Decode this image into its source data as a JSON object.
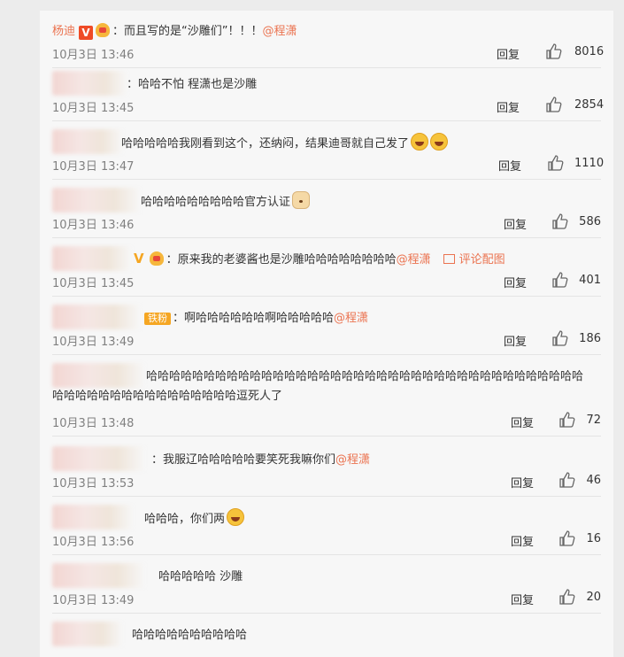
{
  "comments": [
    {
      "name": "杨迪",
      "vip": "V",
      "text": "：而且写的是“沙雕们”！！！",
      "mention": "@程潇",
      "time": "10月3日 13:46",
      "reply": "回复",
      "likes": "8016"
    },
    {
      "name": "",
      "text": "：哈哈不怕 程潇也是沙雕",
      "time": "10月3日 13:45",
      "reply": "回复",
      "likes": "2854"
    },
    {
      "name": "",
      "text": "哈哈哈哈哈我刚看到这个，还纳闷，结果迪哥就自己发了",
      "time": "10月3日 13:47",
      "reply": "回复",
      "likes": "1110"
    },
    {
      "name": "",
      "text": "哈哈哈哈哈哈哈哈哈官方认证",
      "time": "10月3日 13:46",
      "reply": "回复",
      "likes": "586"
    },
    {
      "name": "",
      "vip": "V",
      "text": "：原来我的老婆酱也是沙雕哈哈哈哈哈哈哈哈",
      "mention": "@程潇",
      "pic_link": "评论配图",
      "time": "10月3日 13:45",
      "reply": "回复",
      "likes": "401"
    },
    {
      "name": "",
      "badge": "铁粉",
      "text": "：啊哈哈哈哈哈哈啊哈哈哈哈哈",
      "mention": "@程潇",
      "time": "10月3日 13:49",
      "reply": "回复",
      "likes": "186"
    },
    {
      "name": "",
      "text": "哈哈哈哈哈哈哈哈哈哈哈哈哈哈哈哈哈哈哈哈哈哈哈哈哈哈哈哈哈哈哈哈哈哈哈哈哈哈",
      "text2": "哈哈哈哈哈哈哈哈哈哈哈哈哈哈哈哈逗死人了",
      "time": "10月3日 13:48",
      "reply": "回复",
      "likes": "72"
    },
    {
      "name": "",
      "text": "：我服辽哈哈哈哈哈要笑死我嘛你们",
      "mention": "@程潇",
      "time": "10月3日 13:53",
      "reply": "回复",
      "likes": "46"
    },
    {
      "name": "",
      "text": "哈哈哈，你们两",
      "time": "10月3日 13:56",
      "reply": "回复",
      "likes": "16"
    },
    {
      "name": "",
      "text": "哈哈哈哈哈 沙雕",
      "time": "10月3日 13:49",
      "reply": "回复",
      "likes": "20"
    },
    {
      "name": "",
      "text": "哈哈哈哈哈哈哈哈哈哈",
      "time": "",
      "reply": "",
      "likes": ""
    }
  ]
}
